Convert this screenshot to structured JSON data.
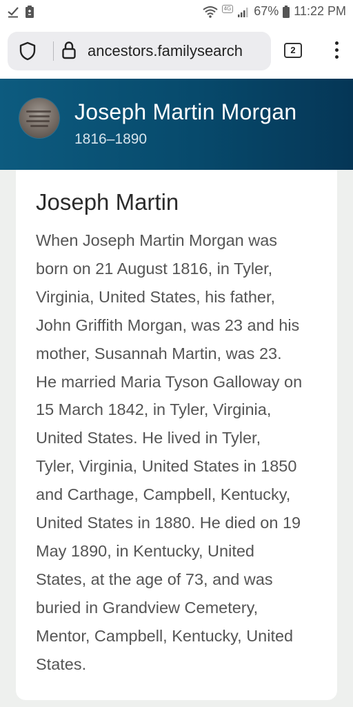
{
  "status_bar": {
    "lte": "4G",
    "battery_percent": "67%",
    "time": "11:22 PM",
    "icons": [
      "check-icon",
      "clipboard-icon",
      "wifi-icon",
      "signal-icon",
      "battery-icon"
    ]
  },
  "browser": {
    "url": "ancestors.familysearch",
    "tab_count": "2",
    "icons": [
      "shield-icon",
      "lock-icon",
      "kebab-menu-icon"
    ]
  },
  "person": {
    "name": "Joseph Martin Morgan",
    "dates": "1816–1890"
  },
  "card": {
    "title": "Joseph Martin",
    "bio": [
      "When Joseph Martin Morgan was",
      "born on 21 August 1816, in Tyler,",
      "Virginia, United States, his father,",
      "John Griffith Morgan, was 23 and his",
      "mother, Susannah Martin, was 23.",
      "He married Maria Tyson Galloway on",
      "15 March 1842, in Tyler, Virginia,",
      "United States. He lived in Tyler,",
      "Tyler, Virginia, United States in 1850",
      "and Carthage, Campbell, Kentucky,",
      "United States in 1880. He died on 19",
      "May 1890, in Kentucky, United",
      "States, at the age of 73, and was",
      "buried in Grandview Cemetery,",
      "Mentor, Campbell, Kentucky, United",
      "States."
    ]
  },
  "colors": {
    "header_start": "#0d5b7f",
    "header_end": "#053656",
    "body_text": "#555555",
    "title_text": "#2b2b2b"
  }
}
